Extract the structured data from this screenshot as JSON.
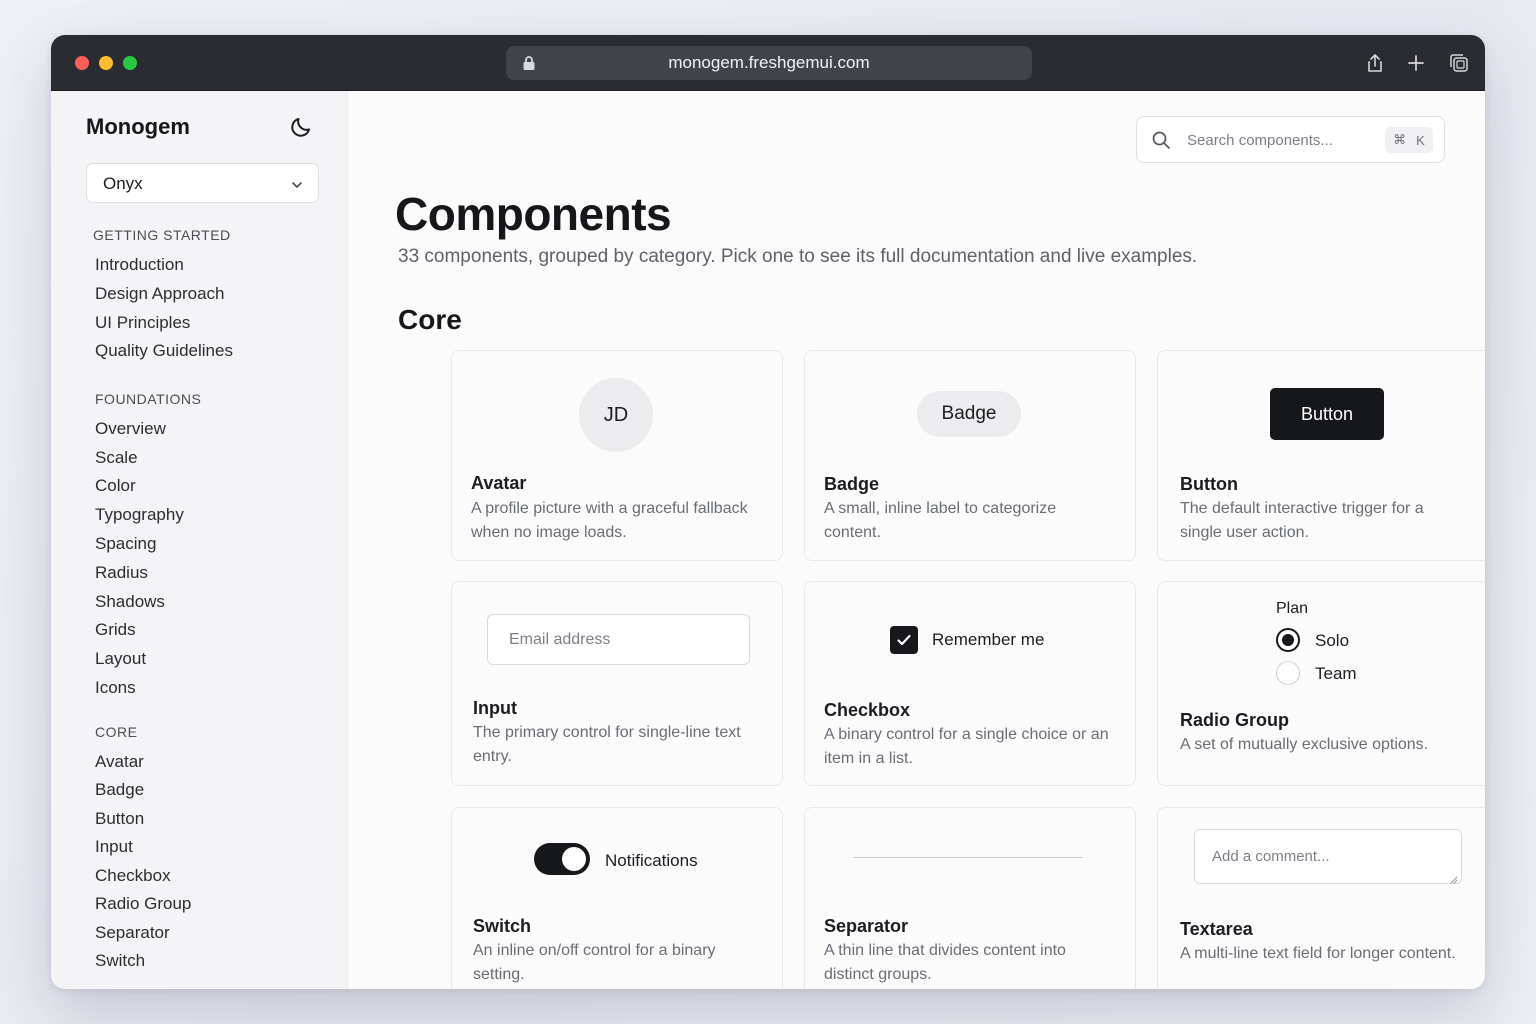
{
  "browser": {
    "url": "monogem.freshgemui.com"
  },
  "sidebar": {
    "brand": "Monogem",
    "theme_select": {
      "value": "Onyx"
    },
    "sections": [
      {
        "heading": "Getting Started",
        "items": [
          "Introduction",
          "Design Approach",
          "UI Principles",
          "Quality Guidelines"
        ]
      },
      {
        "heading": "Foundations",
        "items": [
          "Overview",
          "Scale",
          "Color",
          "Typography",
          "Spacing",
          "Radius",
          "Shadows",
          "Grids",
          "Layout",
          "Icons"
        ]
      },
      {
        "heading": "Core",
        "items": [
          "Avatar",
          "Badge",
          "Button",
          "Input",
          "Checkbox",
          "Radio Group",
          "Separator",
          "Switch"
        ]
      }
    ]
  },
  "search": {
    "placeholder": "Search components...",
    "shortcut_cmd": "⌘",
    "shortcut_key": "K"
  },
  "page": {
    "title": "Components",
    "subtitle": "33 components, grouped by category. Pick one to see its full documentation and live examples.",
    "section": "Core"
  },
  "cards": {
    "avatar": {
      "title": "Avatar",
      "desc": "A profile picture with a graceful fallback when no image loads.",
      "demo_initials": "JD"
    },
    "badge": {
      "title": "Badge",
      "desc": "A small, inline label to categorize content.",
      "demo_label": "Badge"
    },
    "button": {
      "title": "Button",
      "desc": "The default interactive trigger for a single user action.",
      "demo_label": "Button"
    },
    "input": {
      "title": "Input",
      "desc": "The primary control for single-line text entry.",
      "demo_placeholder": "Email address"
    },
    "checkbox": {
      "title": "Checkbox",
      "desc": "A binary control for a single choice or an item in a list.",
      "demo_label": "Remember me",
      "demo_checked": true
    },
    "radio_group": {
      "title": "Radio Group",
      "desc": "A set of mutually exclusive options.",
      "demo_heading": "Plan",
      "options": [
        "Solo",
        "Team"
      ],
      "selected": "Solo"
    },
    "switch": {
      "title": "Switch",
      "desc": "An inline on/off control for a binary setting.",
      "demo_label": "Notifications",
      "demo_on": true
    },
    "separator": {
      "title": "Separator",
      "desc": "A thin line that divides content into distinct groups."
    },
    "textarea": {
      "title": "Textarea",
      "desc": "A multi-line text field for longer content.",
      "demo_placeholder": "Add a comment..."
    }
  },
  "icons": {
    "lock": "lock-icon",
    "share": "share-icon",
    "new_tab": "plus-icon",
    "tabs": "tabs-overview-icon",
    "theme": "moon-icon",
    "search": "search-icon",
    "chevron": "chevron-down-icon",
    "check": "check-icon"
  },
  "colors": {
    "accent": "#15171b",
    "titlebar": "#2a2c31",
    "close": "#ff5f57",
    "minimize": "#febc2e",
    "zoom": "#28c840"
  }
}
